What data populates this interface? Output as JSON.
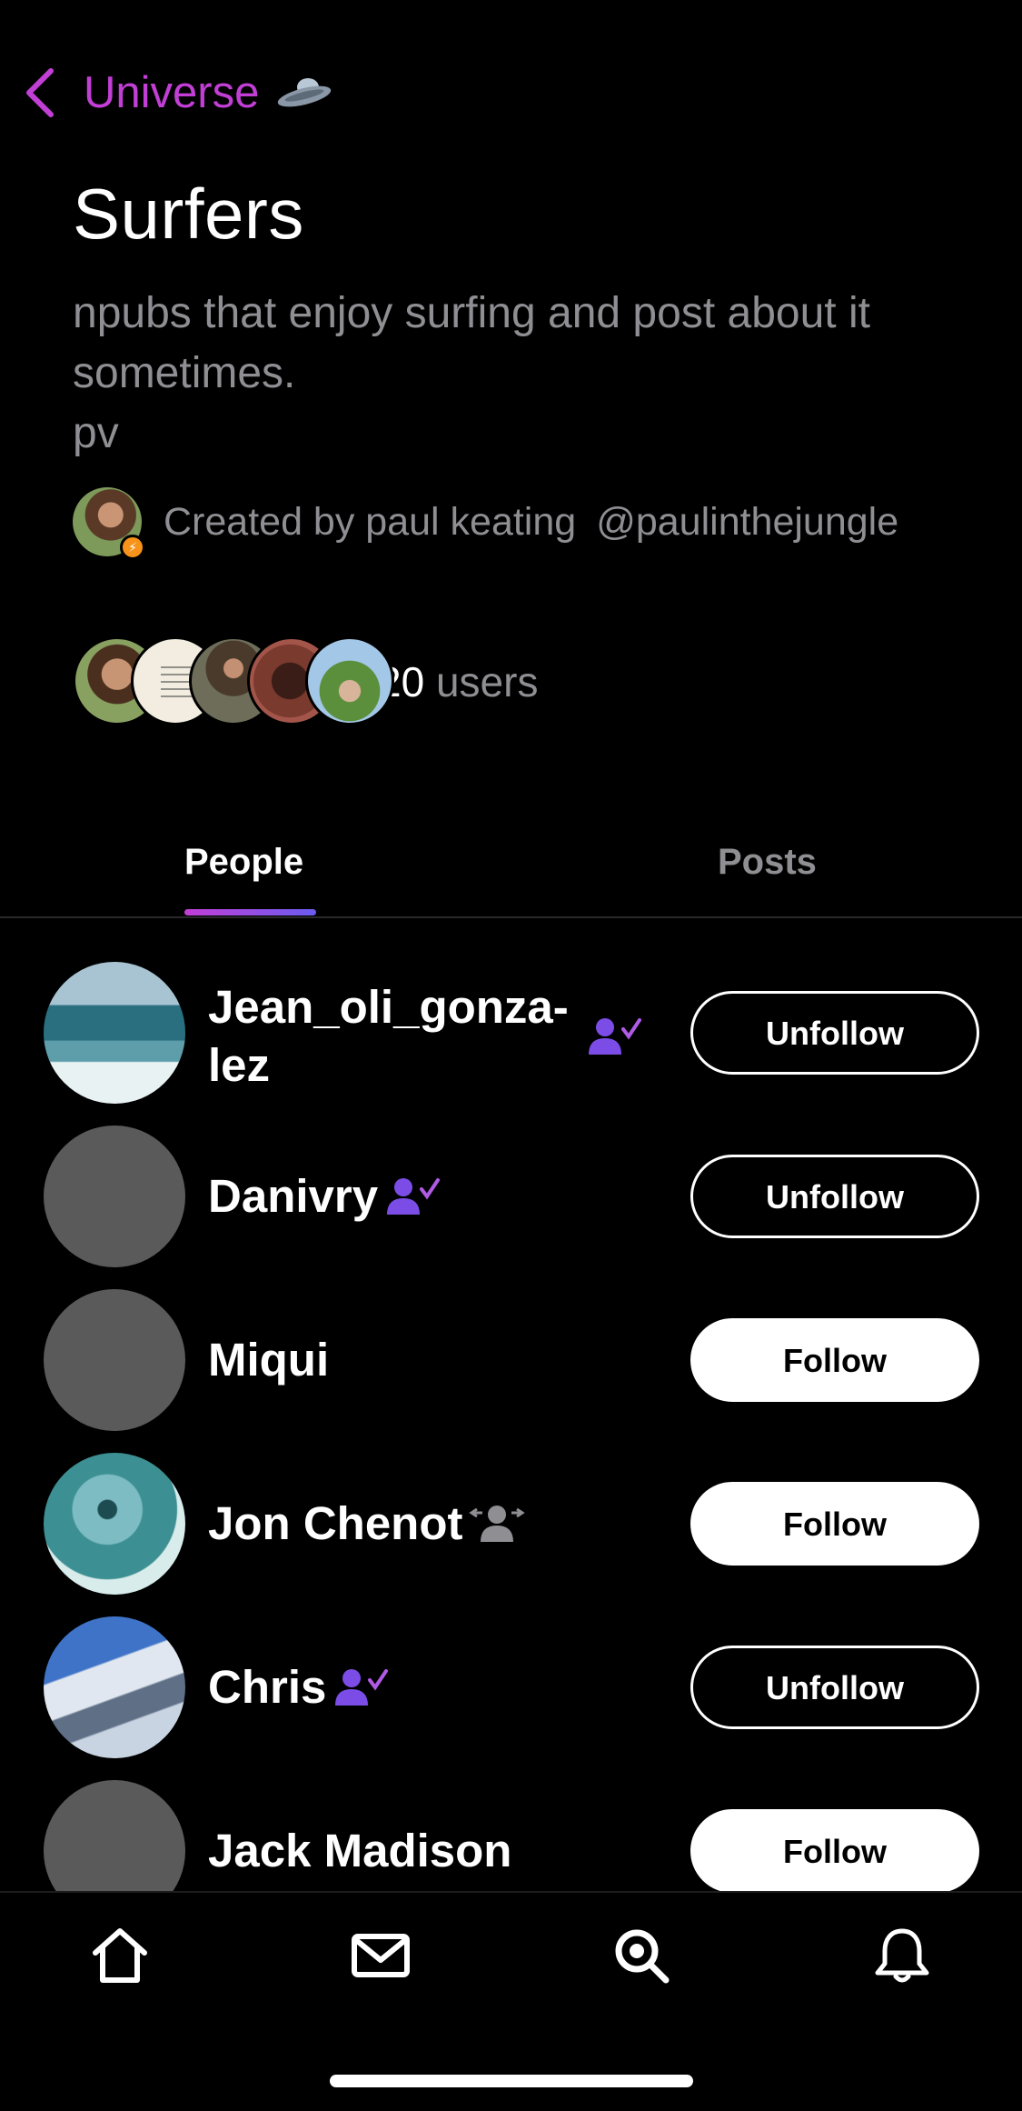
{
  "header": {
    "back_label": "Universe",
    "back_icon": "chevron-left-icon",
    "ufo_icon": "flying-saucer-icon"
  },
  "list_info": {
    "title": "Surfers",
    "description": "npubs that enjoy surfing and post about it sometimes.\npv",
    "created_by": "Created by paul keating",
    "creator_handle": "@paulinthejungle",
    "users_count": "20",
    "users_label": "users"
  },
  "tabs": [
    {
      "label": "People",
      "active": true
    },
    {
      "label": "Posts",
      "active": false
    }
  ],
  "people": [
    {
      "name_line1": "Jean_oli_gonza-",
      "name_line2": "lez",
      "badge": "following-check-icon",
      "button": "Unfollow"
    },
    {
      "name_line1": "Danivry",
      "badge": "following-check-icon",
      "button": "Unfollow"
    },
    {
      "name_line1": "Miqui",
      "badge": "",
      "button": "Follow"
    },
    {
      "name_line1": "Jon Chenot",
      "badge": "mutual-arrows-icon",
      "button": "Follow"
    },
    {
      "name_line1": "Chris",
      "badge": "following-check-icon",
      "button": "Unfollow"
    },
    {
      "name_line1": "Jack Madison",
      "badge": "",
      "button": "Follow"
    }
  ],
  "bottom_nav": [
    "home-icon",
    "mail-icon",
    "search-icon",
    "bell-icon"
  ],
  "colors": {
    "accent": "#c23fd6",
    "badge_purple": "#7b4de6",
    "muted": "#8e8e93"
  }
}
